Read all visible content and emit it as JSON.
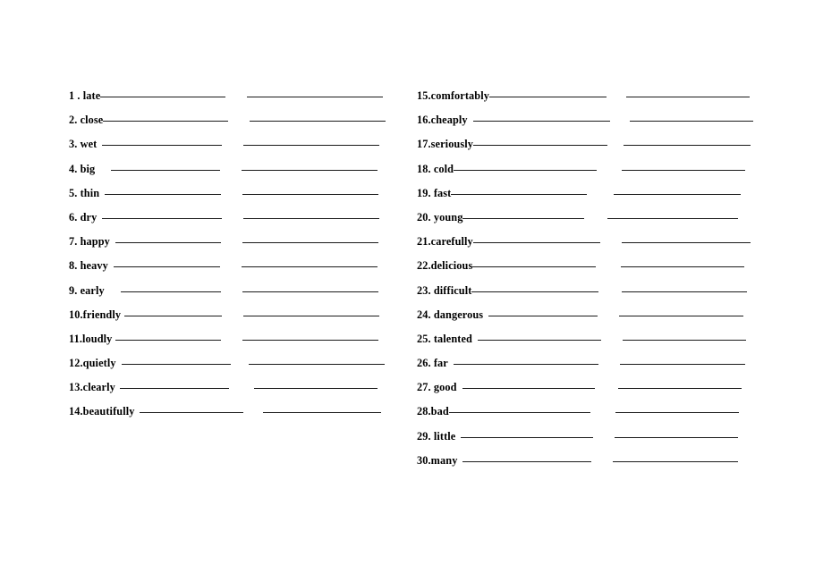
{
  "document": {
    "type": "worksheet",
    "description": "Adjective and adverb comparative/superlative fill-in-the-blank worksheet",
    "background_color": "#ffffff",
    "text_color": "#000000",
    "line_color": "#1a1a1a",
    "blank_count_per_item": 2
  },
  "columns": [
    {
      "name": "left-column",
      "items": [
        {
          "label": "1 .  late",
          "label_w": 48,
          "lead": 0,
          "blank1": 140,
          "gap": 24,
          "blank2": 152
        },
        {
          "label": "2. close",
          "label_w": 48,
          "lead": 0,
          "blank1": 140,
          "gap": 24,
          "blank2": 152
        },
        {
          "label": "3. wet",
          "label_w": 38,
          "lead": 6,
          "blank1": 134,
          "gap": 24,
          "blank2": 152
        },
        {
          "label": "4. big",
          "label_w": 38,
          "lead": 18,
          "blank1": 122,
          "gap": 24,
          "blank2": 152
        },
        {
          "label": "5. thin",
          "label_w": 42,
          "lead": 6,
          "blank1": 130,
          "gap": 24,
          "blank2": 152
        },
        {
          "label": "6. dry",
          "label_w": 38,
          "lead": 6,
          "blank1": 134,
          "gap": 24,
          "blank2": 152
        },
        {
          "label": "7. happy",
          "label_w": 54,
          "lead": 6,
          "blank1": 118,
          "gap": 24,
          "blank2": 152
        },
        {
          "label": "8. heavy",
          "label_w": 53,
          "lead": 6,
          "blank1": 119,
          "gap": 24,
          "blank2": 152
        },
        {
          "label": "9. early",
          "label_w": 48,
          "lead": 18,
          "blank1": 112,
          "gap": 24,
          "blank2": 152
        },
        {
          "label": "10.friendly",
          "label_w": 65,
          "lead": 4,
          "blank1": 109,
          "gap": 24,
          "blank2": 152
        },
        {
          "label": "11.loudly",
          "label_w": 56,
          "lead": 4,
          "blank1": 118,
          "gap": 24,
          "blank2": 152
        },
        {
          "label": "12.quietly",
          "label_w": 58,
          "lead": 6,
          "blank1": 122,
          "gap": 20,
          "blank2": 152
        },
        {
          "label": "13.clearly",
          "label_w": 57,
          "lead": 5,
          "blank1": 122,
          "gap": 28,
          "blank2": 138
        },
        {
          "label": "14.beautifully",
          "label_w": 80,
          "lead": 6,
          "blank1": 116,
          "gap": 22,
          "blank2": 132
        }
      ]
    },
    {
      "name": "right-column",
      "items": [
        {
          "label": "15.comfortably",
          "label_w": 88,
          "lead": 0,
          "blank1": 131,
          "gap": 22,
          "blank2": 138
        },
        {
          "label": "16.cheaply",
          "label_w": 60,
          "lead": 6,
          "blank1": 153,
          "gap": 22,
          "blank2": 138
        },
        {
          "label": "17.seriously",
          "label_w": 69,
          "lead": 0,
          "blank1": 150,
          "gap": 18,
          "blank2": 142
        },
        {
          "label": "18. cold",
          "label_w": 48,
          "lead": 0,
          "blank1": 160,
          "gap": 28,
          "blank2": 138
        },
        {
          "label": "19. fast",
          "label_w": 45,
          "lead": 0,
          "blank1": 152,
          "gap": 30,
          "blank2": 142
        },
        {
          "label": "20. young",
          "label_w": 60,
          "lead": 0,
          "blank1": 136,
          "gap": 26,
          "blank2": 146
        },
        {
          "label": "21.carefully",
          "label_w": 68,
          "lead": 0,
          "blank1": 142,
          "gap": 24,
          "blank2": 144
        },
        {
          "label": "22.delicious",
          "label_w": 69,
          "lead": 0,
          "blank1": 138,
          "gap": 28,
          "blank2": 138
        },
        {
          "label": "23. difficult",
          "label_w": 68,
          "lead": 0,
          "blank1": 142,
          "gap": 26,
          "blank2": 140
        },
        {
          "label": "24. dangerous",
          "label_w": 85,
          "lead": 6,
          "blank1": 122,
          "gap": 24,
          "blank2": 139
        },
        {
          "label": "25. talented",
          "label_w": 67,
          "lead": 6,
          "blank1": 138,
          "gap": 24,
          "blank2": 138
        },
        {
          "label": "26. far",
          "label_w": 39,
          "lead": 6,
          "blank1": 162,
          "gap": 24,
          "blank2": 140
        },
        {
          "label": "27. good",
          "label_w": 50,
          "lead": 6,
          "blank1": 148,
          "gap": 26,
          "blank2": 138
        },
        {
          "label": "28.bad",
          "label_w": 39,
          "lead": 0,
          "blank1": 158,
          "gap": 28,
          "blank2": 138
        },
        {
          "label": "29. little",
          "label_w": 48,
          "lead": 6,
          "blank1": 148,
          "gap": 24,
          "blank2": 138
        },
        {
          "label": "30.many",
          "label_w": 50,
          "lead": 6,
          "blank1": 144,
          "gap": 24,
          "blank2": 140
        }
      ]
    }
  ]
}
